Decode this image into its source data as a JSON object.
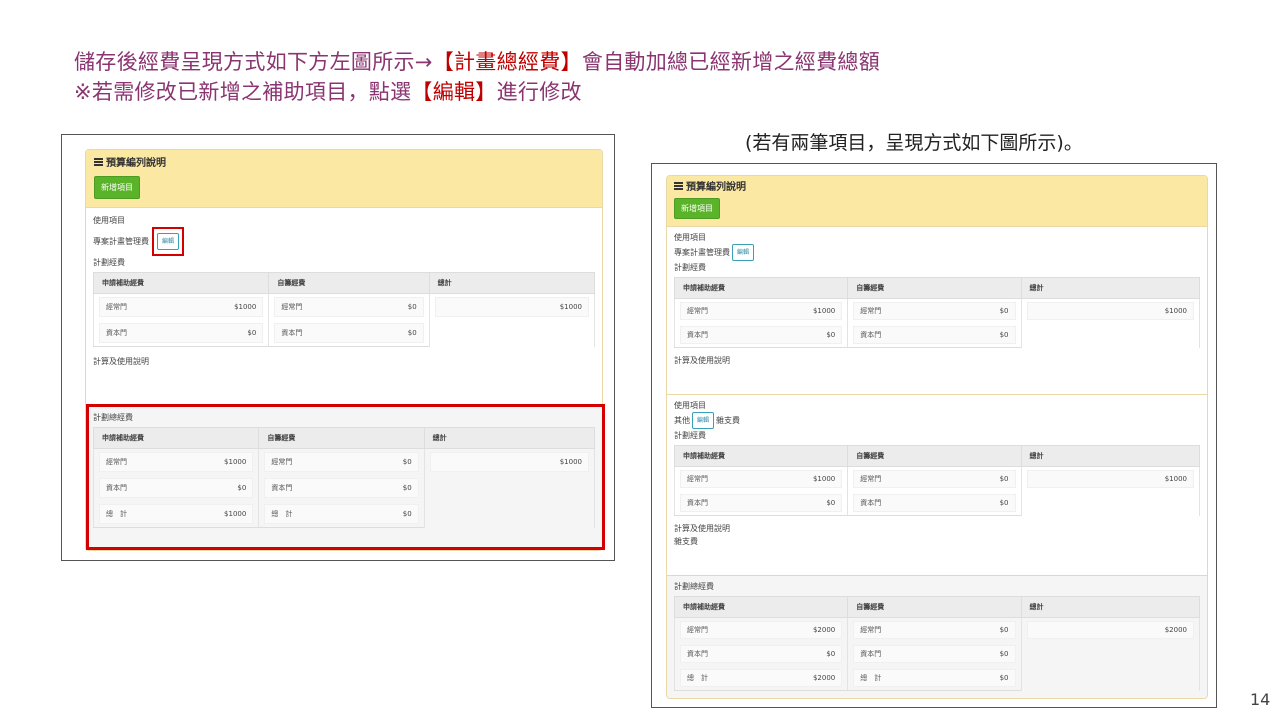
{
  "heading": {
    "line1_pre": "儲存後經費呈現方式如下方左圖所示→",
    "line1_hl": "【計畫總經費】",
    "line1_post": "會自動加總已經新增之經費總額",
    "line2_pre": "※若需修改已新增之補助項目，點選",
    "line2_hl": "【編輯】",
    "line2_post": "進行修改"
  },
  "caption": "(若有兩筆項目，呈現方式如下圖所示)。",
  "page_number": "14",
  "panel": {
    "title": "預算編列說明",
    "add_button": "新增項目",
    "use_item_label": "使用項目",
    "edit_label": "編輯",
    "plan_funding_label": "計劃經費",
    "calc_label": "計算及使用說明",
    "total_section_label": "計劃總經費",
    "columns": [
      "申請補助經費",
      "自籌經費",
      "總計"
    ],
    "row_labels": {
      "recurrent": "經常門",
      "capital": "資本門",
      "sum": "總　計"
    }
  },
  "left": {
    "item": {
      "name": "專案計畫管理費",
      "applied": [
        "$1000",
        "$0"
      ],
      "self": [
        "$0",
        "$0"
      ],
      "total": "$1000"
    },
    "grand": {
      "applied": [
        "$1000",
        "$0",
        "$1000"
      ],
      "self": [
        "$0",
        "$0",
        "$0"
      ],
      "total": "$1000"
    }
  },
  "right": {
    "item1": {
      "name": "專案計畫管理費",
      "applied": [
        "$1000",
        "$0"
      ],
      "self": [
        "$0",
        "$0"
      ],
      "total": "$1000"
    },
    "item2": {
      "name_pre": "其他",
      "name_post": "雜支費",
      "applied": [
        "$1000",
        "$0"
      ],
      "self": [
        "$0",
        "$0"
      ],
      "total": "$1000",
      "note": "雜支費"
    },
    "grand": {
      "applied": [
        "$2000",
        "$0",
        "$2000"
      ],
      "self": [
        "$0",
        "$0",
        "$0"
      ],
      "total": "$2000"
    }
  },
  "colors": {
    "accent_red": "#c00000",
    "title_purple": "#8a3470",
    "header_yellow": "#fbe9a3",
    "button_green": "#5bb32a"
  }
}
